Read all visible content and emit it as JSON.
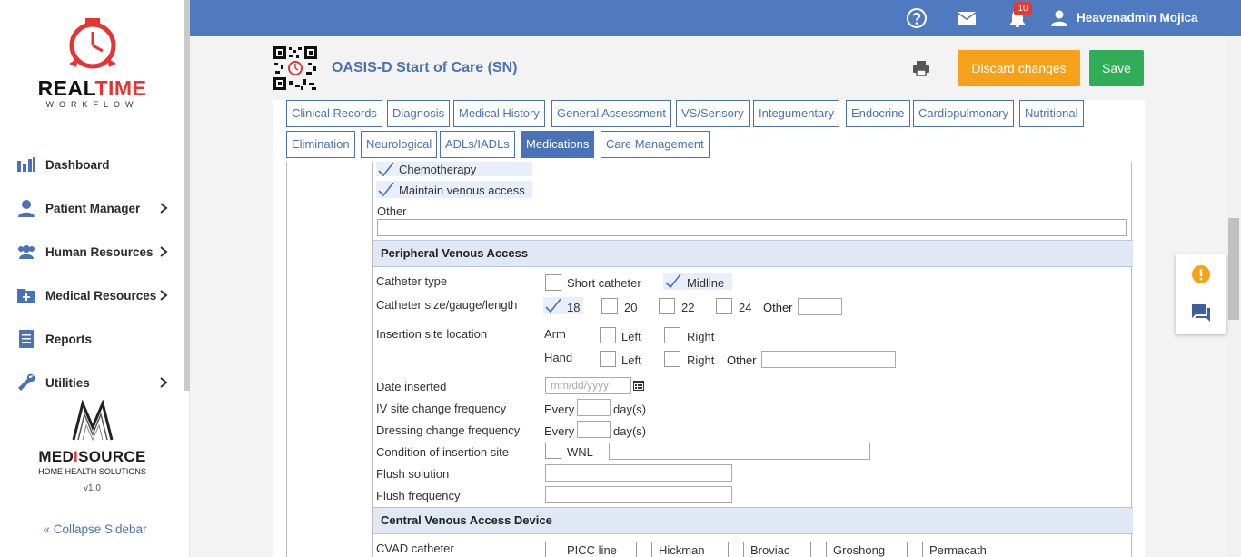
{
  "sidebar": {
    "brand": {
      "part1": "REAL",
      "part2": "TIME",
      "sub": "WORKFLOW"
    },
    "items": [
      {
        "label": "Dashboard",
        "icon": "bar-chart-icon",
        "has_children": false
      },
      {
        "label": "Patient Manager",
        "icon": "user-icon",
        "has_children": true
      },
      {
        "label": "Human Resources",
        "icon": "users-icon",
        "has_children": true
      },
      {
        "label": "Medical Resources",
        "icon": "medical-folder-icon",
        "has_children": true
      },
      {
        "label": "Reports",
        "icon": "document-icon",
        "has_children": false
      },
      {
        "label": "Utilities",
        "icon": "wrench-icon",
        "has_children": true
      }
    ],
    "partner": {
      "name_a": "MED",
      "name_i": "I",
      "name_b": "SOURCE",
      "sub": "HOME HEALTH SOLUTIONS",
      "version": "v1.0"
    },
    "collapse_label": "« Collapse Sidebar"
  },
  "topbar": {
    "notifications_count": "10",
    "user_name": "Heavenadmin Mojica",
    "color": "#4f7ac0"
  },
  "header": {
    "title": "OASIS-D Start of Care (SN)",
    "discard_label": "Discard changes",
    "save_label": "Save"
  },
  "tabs": [
    {
      "label": "Clinical Records",
      "active": false
    },
    {
      "label": "Diagnosis",
      "active": false
    },
    {
      "label": "Medical History",
      "active": false
    },
    {
      "label": "General Assessment",
      "active": false
    },
    {
      "label": "VS/Sensory",
      "active": false
    },
    {
      "label": "Integumentary",
      "active": false
    },
    {
      "label": "Endocrine",
      "active": false
    },
    {
      "label": "Cardiopulmonary",
      "active": false
    },
    {
      "label": "Nutritional",
      "active": false
    },
    {
      "label": "Elimination",
      "active": false
    },
    {
      "label": "Neurological",
      "active": false
    },
    {
      "label": "ADLs/IADLs",
      "active": false
    },
    {
      "label": "Medications",
      "active": true
    },
    {
      "label": "Care Management",
      "active": false
    }
  ],
  "form": {
    "purpose": {
      "chemotherapy": "Chemotherapy",
      "maintain": "Maintain venous access",
      "other_label": "Other"
    },
    "pva": {
      "section_title": "Peripheral Venous Access",
      "catheter_type_label": "Catheter type",
      "short_catheter": "Short catheter",
      "midline": "Midline",
      "size_label": "Catheter size/gauge/length",
      "sizes": [
        "18",
        "20",
        "22",
        "24"
      ],
      "size_checked": "18",
      "other_label": "Other",
      "insertion_label": "Insertion site location",
      "arm": "Arm",
      "hand": "Hand",
      "left": "Left",
      "right": "Right",
      "date_label": "Date inserted",
      "date_placeholder": "mm/dd/yyyy",
      "iv_freq_label": "IV site change frequency",
      "dressing_label": "Dressing change frequency",
      "every": "Every",
      "days": "day(s)",
      "condition_label": "Condition of insertion site",
      "wnl": "WNL",
      "flush_solution_label": "Flush solution",
      "flush_frequency_label": "Flush frequency"
    },
    "cvad": {
      "section_title": "Central Venous Access Device",
      "catheter_label": "CVAD catheter",
      "options": [
        "PICC line",
        "Hickman",
        "Broviac",
        "Groshong",
        "Permacath"
      ]
    }
  }
}
